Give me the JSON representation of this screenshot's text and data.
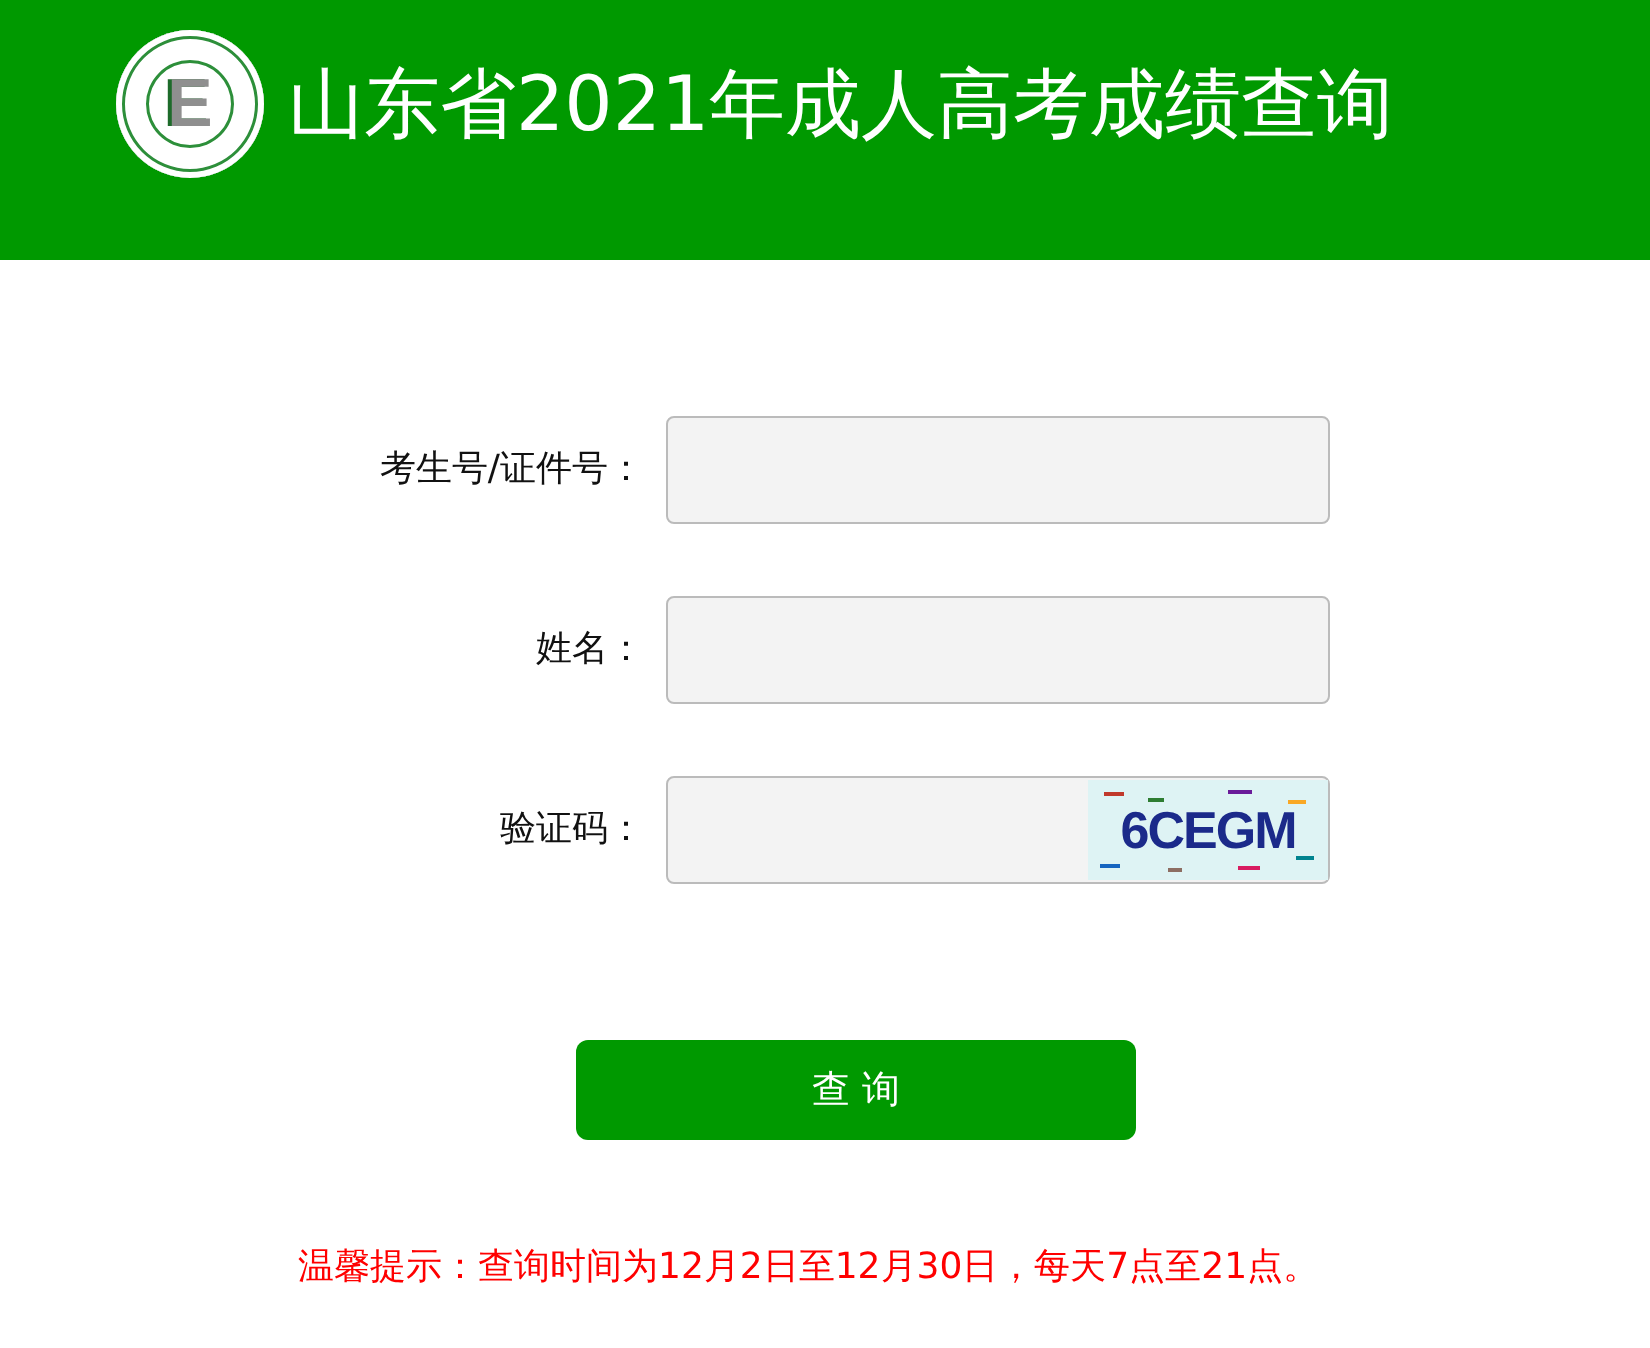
{
  "header": {
    "logo": {
      "letter": "E"
    },
    "title": "山东省2021年成人高考成绩查询"
  },
  "form": {
    "fields": [
      {
        "kind": "text",
        "label": "考生号/证件号："
      },
      {
        "kind": "text",
        "label": "姓名："
      },
      {
        "kind": "captcha",
        "label": "验证码：",
        "captcha": "6CEGM"
      }
    ]
  },
  "submit_button": "查 询",
  "notice": "温馨提示：查询时间为12月2日至12月30日，每天7点至21点。"
}
